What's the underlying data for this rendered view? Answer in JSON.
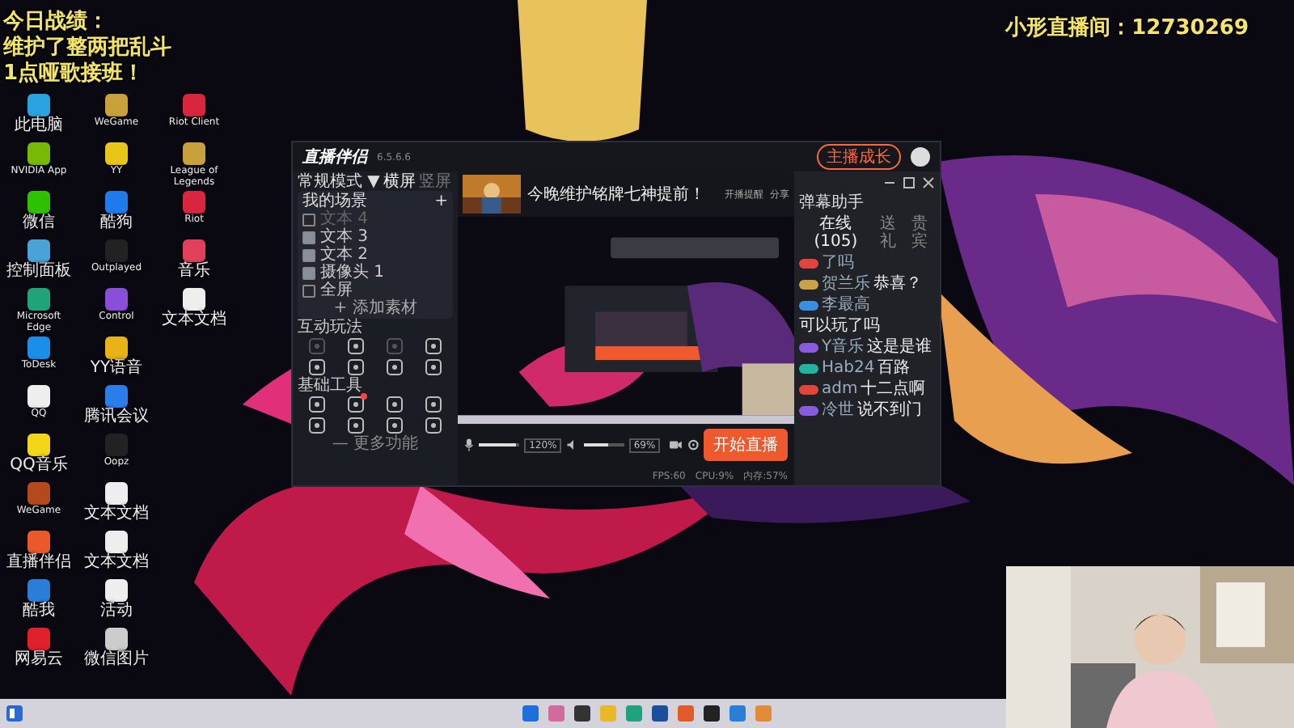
{
  "overlay": {
    "notes": [
      "今日战绩：",
      "维护了整两把乱斗",
      "1点哑歌接班！"
    ],
    "room": "小形直播间：12730269"
  },
  "desktop_columns": [
    [
      {
        "label": "此电脑",
        "color": "#2aa3e0"
      },
      {
        "label": "NVIDIA App",
        "color": "#76b900"
      },
      {
        "label": "微信",
        "color": "#2dc100"
      },
      {
        "label": "控制面板",
        "color": "#4aa3d8"
      },
      {
        "label": "Microsoft Edge",
        "color": "#1fa37a"
      },
      {
        "label": "ToDesk",
        "color": "#1b8ee8"
      },
      {
        "label": "QQ",
        "color": "#eeeeee"
      },
      {
        "label": "QQ音乐",
        "color": "#f2d61a"
      },
      {
        "label": "WeGame",
        "color": "#b44a1c"
      },
      {
        "label": "直播伴侣",
        "color": "#e85a2a"
      },
      {
        "label": "酷我",
        "color": "#2a7ed8"
      },
      {
        "label": "网易云",
        "color": "#e0202a"
      }
    ],
    [
      {
        "label": "WeGame",
        "color": "#c8a13a"
      },
      {
        "label": "YY",
        "color": "#e8c619"
      },
      {
        "label": "酷狗",
        "color": "#1f7aea"
      },
      {
        "label": "Outplayed",
        "color": "#222222"
      },
      {
        "label": "Control",
        "color": "#8a4fd8"
      },
      {
        "label": "YY语音",
        "color": "#e8b319"
      },
      {
        "label": "腾讯会议",
        "color": "#2b7de9"
      },
      {
        "label": "Oopz",
        "color": "#222222"
      },
      {
        "label": "文本文档",
        "color": "#eeeeee"
      },
      {
        "label": "文本文档",
        "color": "#eeeeee"
      },
      {
        "label": "活动",
        "color": "#eeeeee"
      },
      {
        "label": "微信图片",
        "color": "#cccccc"
      }
    ],
    [
      {
        "label": "Riot Client",
        "color": "#d7263d"
      },
      {
        "label": "League of Legends",
        "color": "#c8a13a"
      },
      {
        "label": "Riot",
        "color": "#d7263d"
      },
      {
        "label": "音乐",
        "color": "#e0405a"
      },
      {
        "label": "文本文档",
        "color": "#eeeeee"
      }
    ]
  ],
  "app": {
    "title": "直播伴侣",
    "version": "6.5.6.6",
    "growth_button": "主播成长",
    "left": {
      "mode": "常规模式 ▼",
      "orientations": [
        {
          "label": "横屏",
          "selected": true
        },
        {
          "label": "竖屏",
          "selected": false
        }
      ],
      "scenes_title": "我的场景",
      "add": "+",
      "scenes": [
        {
          "label": "文本 4",
          "checked": false,
          "disabled": true
        },
        {
          "label": "文本 3",
          "checked": true,
          "disabled": false
        },
        {
          "label": "文本 2",
          "checked": true,
          "disabled": false
        },
        {
          "label": "摄像头 1",
          "checked": true,
          "disabled": false
        },
        {
          "label": "全屏",
          "checked": false,
          "disabled": false
        }
      ],
      "add_material": "+ 添加素材",
      "sections": [
        {
          "title": "互动玩法",
          "tools": [
            {
              "disabled": true,
              "badge": false
            },
            {
              "disabled": false,
              "badge": false
            },
            {
              "disabled": true,
              "badge": false
            },
            {
              "disabled": false,
              "badge": false
            },
            {
              "disabled": false,
              "badge": false
            },
            {
              "disabled": false,
              "badge": false
            },
            {
              "disabled": false,
              "badge": false
            },
            {
              "disabled": false,
              "badge": false
            }
          ]
        },
        {
          "title": "基础工具",
          "tools": [
            {
              "disabled": false,
              "badge": false
            },
            {
              "disabled": false,
              "badge": true
            },
            {
              "disabled": false,
              "badge": false
            },
            {
              "disabled": false,
              "badge": false
            },
            {
              "disabled": false,
              "badge": false
            },
            {
              "disabled": false,
              "badge": false
            },
            {
              "disabled": false,
              "badge": false
            },
            {
              "disabled": false,
              "badge": false
            }
          ]
        }
      ],
      "more": "— 更多功能"
    },
    "center": {
      "stream_title": "今晚维护铭牌七神提前！",
      "actions": [
        "开播提醒",
        "分享"
      ],
      "mic": {
        "level": 0.9,
        "reading": "120%"
      },
      "speaker": {
        "level": 0.6,
        "reading": "69%"
      },
      "start_button": "开始直播",
      "status": [
        "FPS:60",
        "CPU:9%",
        "内存:57%"
      ]
    },
    "right": {
      "title": "弹幕助手",
      "tabs": [
        {
          "label": "在线(105)",
          "selected": true
        },
        {
          "label": "送礼",
          "selected": false
        },
        {
          "label": "贵宾",
          "selected": false
        }
      ],
      "messages": [
        {
          "color": "#e0443a",
          "user": "了吗"
        },
        {
          "color": "#c9a24a",
          "user": "贺兰乐",
          "text": "恭喜？"
        },
        {
          "color": "#3a8fe0",
          "user": "李最高",
          "text": "可以玩了吗"
        },
        {
          "color": "#8a5be0",
          "user": "Y音乐",
          "text": "这是是谁"
        },
        {
          "color": "#24b3a0",
          "user": "Hab24",
          "text": "百路"
        },
        {
          "color": "#e0443a",
          "user": "adm",
          "text": "十二点啊"
        },
        {
          "color": "#8a5be0",
          "user": "冷世",
          "text": "说不到门"
        }
      ]
    }
  }
}
